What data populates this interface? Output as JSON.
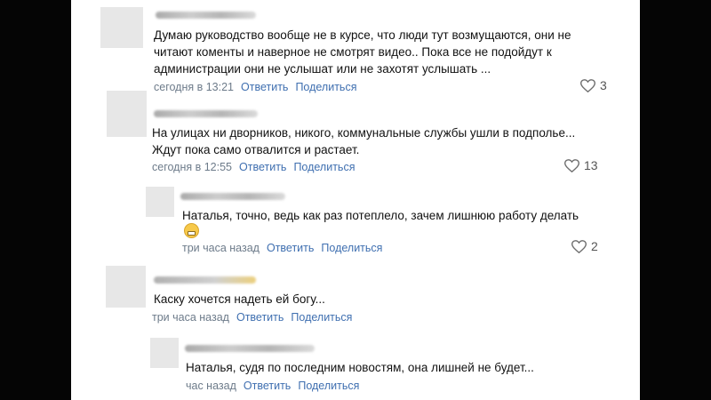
{
  "comments": [
    {
      "lines": [
        "Думаю руководство вообще не в курсе, что люди тут возмущаются, они не",
        "читают коменты и наверное не смотрят видео.. Пока все не подойдут к",
        "администрации они не услышат или не захотят услышать ..."
      ],
      "time": "сегодня в 13:21",
      "reply": "Ответить",
      "share": "Поделиться",
      "likes": "3"
    },
    {
      "lines": [
        "На улицах ни дворников, никого, коммунальные службы ушли в подполье...",
        "Ждут пока само отвалится и растает."
      ],
      "time": "сегодня в 12:55",
      "reply": "Ответить",
      "share": "Поделиться",
      "likes": "13"
    },
    {
      "lines": [
        "Наталья, точно, ведь как раз потеплело, зачем лишнюю работу делать"
      ],
      "emoji": "grimacing-emoji",
      "time": "три часа назад",
      "reply": "Ответить",
      "share": "Поделиться",
      "likes": "2"
    },
    {
      "lines": [
        "Каску хочется надеть ей богу..."
      ],
      "time": "три часа назад",
      "reply": "Ответить",
      "share": "Поделиться"
    },
    {
      "lines": [
        "Наталья, судя по последним новостям, она лишней не будет..."
      ],
      "time": "час назад",
      "reply": "Ответить",
      "share": "Поделиться"
    }
  ],
  "colors": {
    "link": "#3f6fb0",
    "meta": "#6d7b8a",
    "text": "#111111",
    "avatar": "#e7e7e7"
  }
}
